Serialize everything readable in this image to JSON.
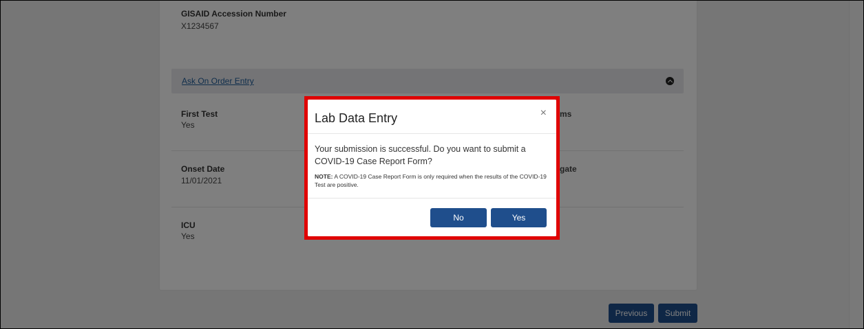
{
  "page": {
    "fields": {
      "gisaid_label": "GISAID Accession Number",
      "gisaid_value": "X1234567",
      "first_test_label": "First Test",
      "first_test_value": "Yes",
      "onset_date_label": "Onset Date",
      "onset_date_value": "11/01/2021",
      "icu_label": "ICU",
      "icu_value": "Yes",
      "right_col_1_partial": "ms",
      "right_col_2_partial": "gate"
    },
    "section": {
      "title": "Ask On Order Entry"
    },
    "footer": {
      "previous_label": "Previous",
      "submit_label": "Submit"
    }
  },
  "modal": {
    "title": "Lab Data Entry",
    "close_symbol": "×",
    "message": "Your submission is successful. Do you want to submit a COVID-19 Case Report Form?",
    "note_label": "NOTE:",
    "note_text": "A COVID-19 Case Report Form is only required when the results of the COVID-19 Test are positive.",
    "no_label": "No",
    "yes_label": "Yes"
  },
  "colors": {
    "primary": "#1f4e8c",
    "highlight": "#e00000",
    "link": "#1f5c99"
  }
}
